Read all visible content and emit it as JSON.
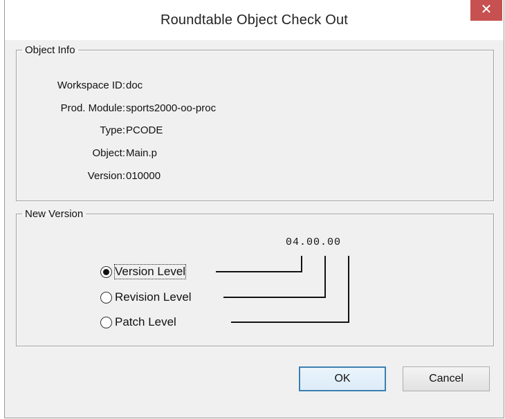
{
  "window": {
    "title": "Roundtable Object Check Out",
    "close_label": "✕"
  },
  "object_info": {
    "legend": "Object Info",
    "rows": [
      {
        "label": "Workspace ID:",
        "value": "doc"
      },
      {
        "label": "Prod. Module:",
        "value": "sports2000-oo-proc"
      },
      {
        "label": "Type:",
        "value": "PCODE"
      },
      {
        "label": "Object:",
        "value": "Main.p"
      },
      {
        "label": "Version:",
        "value": "010000"
      }
    ]
  },
  "new_version": {
    "legend": "New Version",
    "version_display": "04.00.00",
    "options": [
      {
        "label": "Version Level",
        "checked": true
      },
      {
        "label": "Revision Level",
        "checked": false
      },
      {
        "label": "Patch Level",
        "checked": false
      }
    ]
  },
  "buttons": {
    "ok": "OK",
    "cancel": "Cancel"
  },
  "colors": {
    "close_button": "#c75050",
    "dialog_background": "#f0f0f0",
    "default_button_border": "#3c7fb1"
  }
}
